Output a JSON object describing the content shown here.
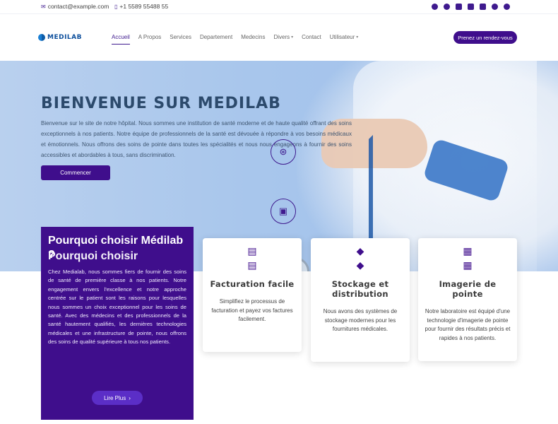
{
  "topbar": {
    "email": "contact@example.com",
    "phone": "+1 5589 55488 55",
    "social_icons": [
      "facebook-icon",
      "twitter-icon",
      "linkedin-icon",
      "instagram-icon",
      "youtube-icon",
      "whatsapp-icon",
      "telegram-icon"
    ]
  },
  "header": {
    "logo_text": "MEDILAB",
    "nav": [
      {
        "label": "Accueil",
        "active": true
      },
      {
        "label": "A Propos"
      },
      {
        "label": "Services"
      },
      {
        "label": "Departement"
      },
      {
        "label": "Medecins"
      },
      {
        "label": "Divers",
        "dropdown": true
      },
      {
        "label": "Contact"
      },
      {
        "label": "Utilisateur",
        "dropdown": true
      }
    ],
    "cta": "Prenez un rendez-vous"
  },
  "hero": {
    "title": "BIENVENUE SUR MEDILAB",
    "lead": "Bienvenue sur le site de notre hôpital. Nous sommes une institution de santé moderne et de haute qualité offrant des soins exceptionnels à nos patients. Notre équipe de professionnels de la santé est dévouée à répondre à vos besoins médicaux et émotionnels. Nous offrons des soins de pointe dans toutes les spécialités et nous nous engageons à fournir des soins accessibles et abordables à tous, sans discrimination.",
    "button": "Commencer"
  },
  "why": {
    "title": "Pourquoi choisir Médilab ?",
    "ghost_title": "Pourquoi choisir",
    "text": "Chez Medialab, nous sommes fiers de fournir des soins de santé de première classe à nos patients. Notre engagement envers l'excellence et notre approche centrée sur le patient sont les raisons pour lesquelles nous sommes un choix exceptionnel pour les soins de santé. Avec des médecins et des professionnels de la santé hautement qualifiés, les dernières technologies médicales et une infrastructure de pointe, nous offrons des soins de qualité supérieure à tous nos patients.",
    "button": "Lire Plus"
  },
  "cards": [
    {
      "icon": "receipt-icon",
      "title": "Facturation facile",
      "text": "Simplifiez le processus de facturation et payez vos factures facilement."
    },
    {
      "icon": "box-icon",
      "title": "Stockage et distribution",
      "text": "Nous avons des systèmes de stockage modernes pour les fournitures médicales."
    },
    {
      "icon": "images-icon",
      "title": "Imagerie de pointe",
      "text": "Notre laboratoire est équipé d'une technologie d'imagerie de pointe pour fournir des résultats précis et rapides à nos patients."
    }
  ],
  "colors": {
    "brand": "#3f0e8c",
    "hero_bg": "#a8c6ec",
    "title": "#2c4a6c"
  }
}
